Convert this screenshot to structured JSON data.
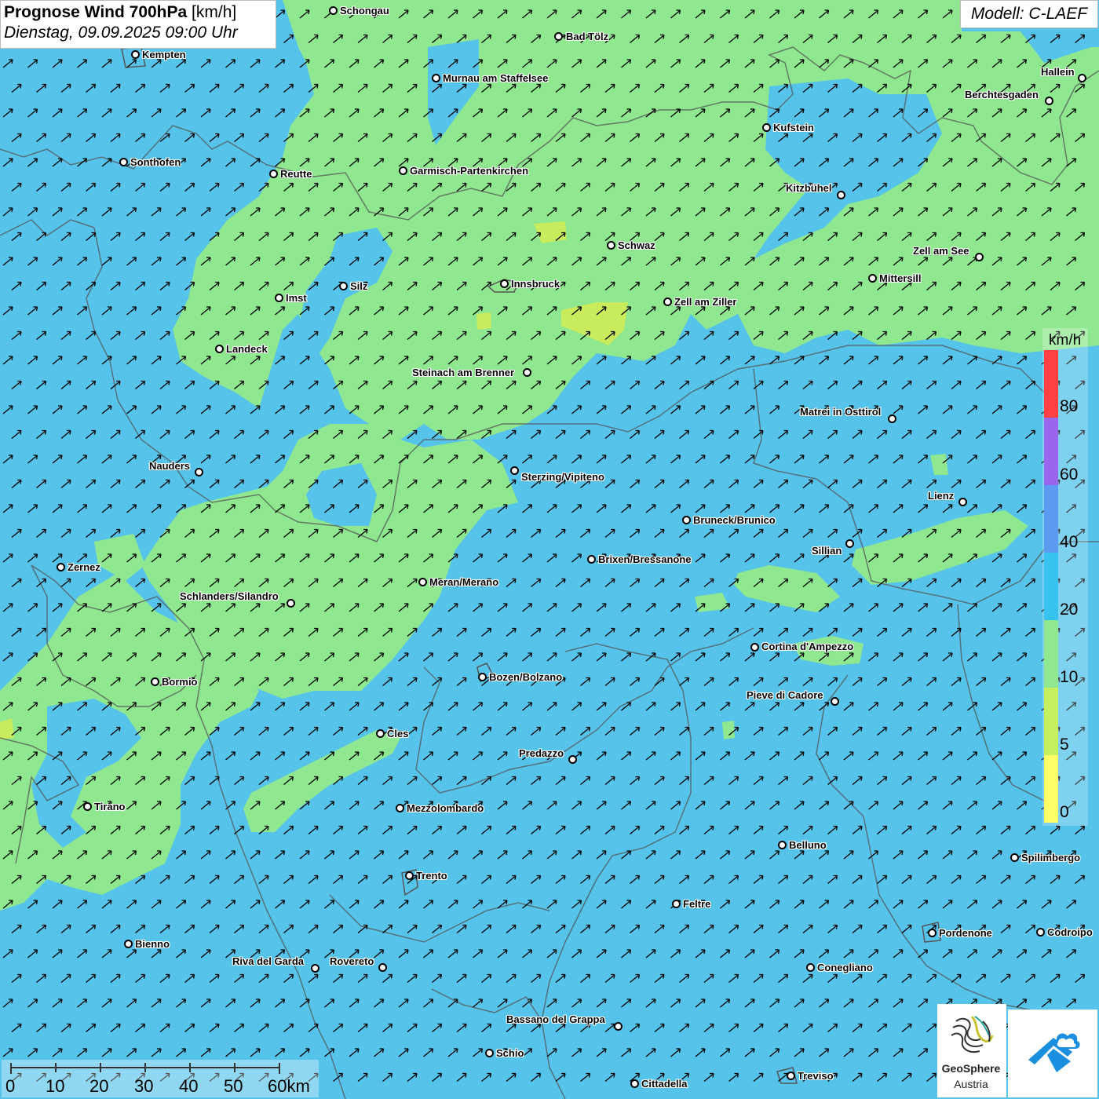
{
  "header": {
    "title_bold": "Prognose Wind 700hPa",
    "title_unit": "[km/h]",
    "datetime": "Dienstag, 09.09.2025 09:00 Uhr",
    "model": "Modell: C-LAEF"
  },
  "legend": {
    "unit": "km/h",
    "ticks": [
      "80",
      "60",
      "40",
      "20",
      "10",
      "5",
      "0"
    ],
    "colors": [
      "#ff4040",
      "#9a66ee",
      "#5b9cf2",
      "#37c2ef",
      "#8fe88f",
      "#c6f05e",
      "#ffff66"
    ]
  },
  "scale": {
    "labels": [
      "0",
      "10",
      "20",
      "30",
      "40",
      "50",
      "60km"
    ]
  },
  "brand": {
    "name": "GeoSphere",
    "sub": "Austria"
  },
  "cities": [
    "Schongau",
    "Bad Tölz",
    "Kempten",
    "Murnau am Staffelsee",
    "Hallein",
    "Berchtesgaden",
    "Kufstein",
    "Sonthofen",
    "Reutte",
    "Garmisch-Partenkirchen",
    "Kitzbühel",
    "Schwaz",
    "Zell am See",
    "Mittersill",
    "Innsbruck",
    "Silz",
    "Imst",
    "Zell am Ziller",
    "Landeck",
    "Steinach am Brenner",
    "Matrei in Osttirol",
    "Nauders",
    "Sterzing/Vipiteno",
    "Lienz",
    "Bruneck/Brunico",
    "Sillian",
    "Zernez",
    "Brixen/Bressanone",
    "Meran/Merano",
    "Schlanders/Silandro",
    "Cortina d'Ampezzo",
    "Bozen/Bolzano",
    "Bormio",
    "Pieve di Cadore",
    "Cles",
    "Predazzo",
    "Tirano",
    "Mezzolombardo",
    "Belluno",
    "Spilimbergo",
    "Trento",
    "Feltre",
    "Bienno",
    "Pordenone",
    "Codroipo",
    "Riva del Garda",
    "Rovereto",
    "Conegliano",
    "Bassano del Grappa",
    "Schio",
    "Treviso",
    "Cittadella"
  ],
  "colors": {
    "field_blue": "#55c3ea",
    "field_green": "#8fe88f",
    "field_yellow_green": "#c8ec5c",
    "border": "#555555",
    "arrow": "#000000"
  }
}
